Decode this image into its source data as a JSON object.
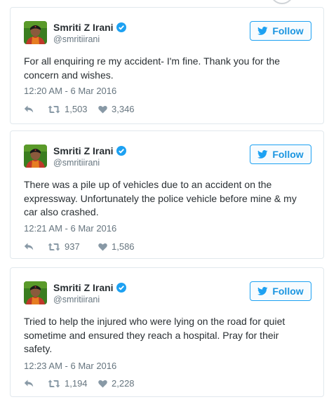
{
  "tweets": [
    {
      "author": "Smriti Z Irani",
      "handle": "@smritiirani",
      "follow_label": "Follow",
      "text": "For all enquiring re my accident- I'm fine. Thank you for the concern and wishes.",
      "timestamp": "12:20 AM - 6 Mar 2016",
      "retweets": "1,503",
      "likes": "3,346"
    },
    {
      "author": "Smriti Z Irani",
      "handle": "@smritiirani",
      "follow_label": "Follow",
      "text": "There was a pile up of vehicles due to an accident on the expressway. Unfortunately the police vehicle before mine & my car also crashed.",
      "timestamp": "12:21 AM - 6 Mar 2016",
      "retweets": "937",
      "likes": "1,586"
    },
    {
      "author": "Smriti Z Irani",
      "handle": "@smritiirani",
      "follow_label": "Follow",
      "text": "Tried to help the injured who were lying on the road for quiet sometime and ensured they reach a hospital. Pray for their safety.",
      "timestamp": "12:23 AM - 6 Mar 2016",
      "retweets": "1,194",
      "likes": "2,228"
    }
  ],
  "icons": {
    "verified": "verified-badge-icon",
    "bird": "twitter-bird-icon",
    "reply": "reply-arrow-icon",
    "retweet": "retweet-icon",
    "like": "heart-icon"
  },
  "colors": {
    "accent": "#1da1f2",
    "text": "#292f33",
    "muted": "#66757f",
    "border": "#e1e8ed",
    "avatar_bg": "#3a7d1f",
    "saree": "#c0392b"
  }
}
